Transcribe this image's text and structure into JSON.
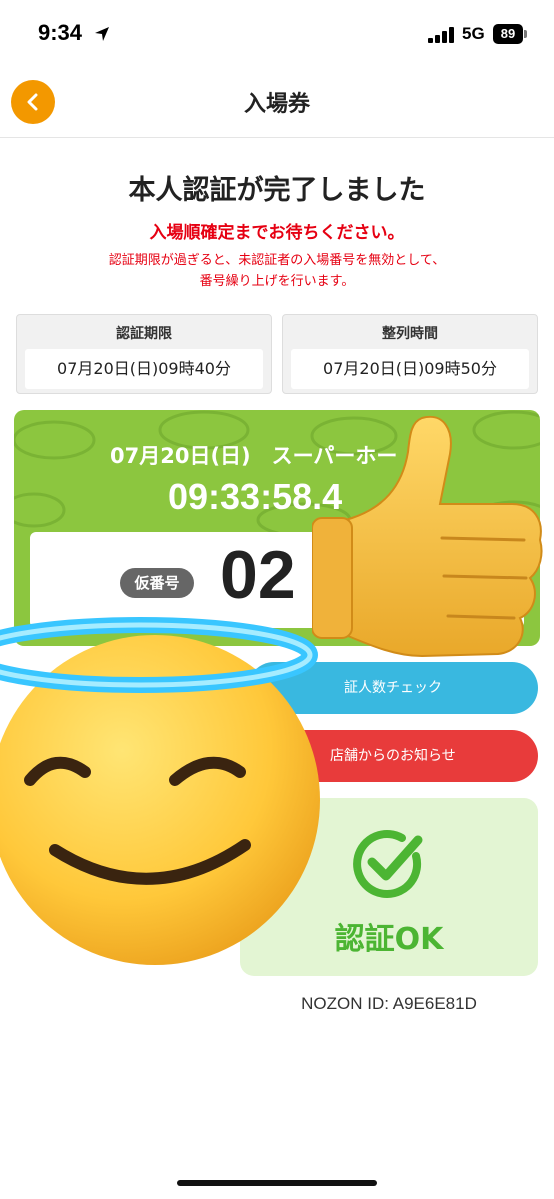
{
  "status_bar": {
    "time": "9:34",
    "network": "5G",
    "battery": "89"
  },
  "nav": {
    "title": "入場券",
    "back_icon": "chevron-left-icon"
  },
  "main": {
    "heading": "本人認証が完了しました",
    "wait_message": "入場順確定までお待ちください。",
    "note_line1": "認証期限が過ぎると、未認証者の入場番号を無効として、",
    "note_line2": "番号繰り上げを行います。"
  },
  "deadline": {
    "label": "認証期限",
    "value": "07月20日(日)09時40分"
  },
  "lineup": {
    "label": "整列時間",
    "value": "07月20日(日)09時50分"
  },
  "ticket": {
    "date_line": "07月20日(日)　スーパーホー",
    "time": "09:33:58.4",
    "temp_label": "仮番号",
    "temp_number": "02"
  },
  "buttons": {
    "check": "証人数チェック",
    "news": "店舗からのお知らせ"
  },
  "auth": {
    "text": "認証OK",
    "icon": "check-circle-icon"
  },
  "nozon": {
    "id_text": "NOZON ID: A9E6E81D"
  },
  "colors": {
    "accent_orange": "#f39800",
    "alert_red": "#e60012",
    "ticket_green": "#8cc63f",
    "check_blue": "#39b8e0",
    "news_red": "#e83b3b",
    "auth_green": "#4cb533"
  },
  "stickers": [
    "thumbs-up-emoji",
    "smiling-face-with-halo-emoji"
  ]
}
